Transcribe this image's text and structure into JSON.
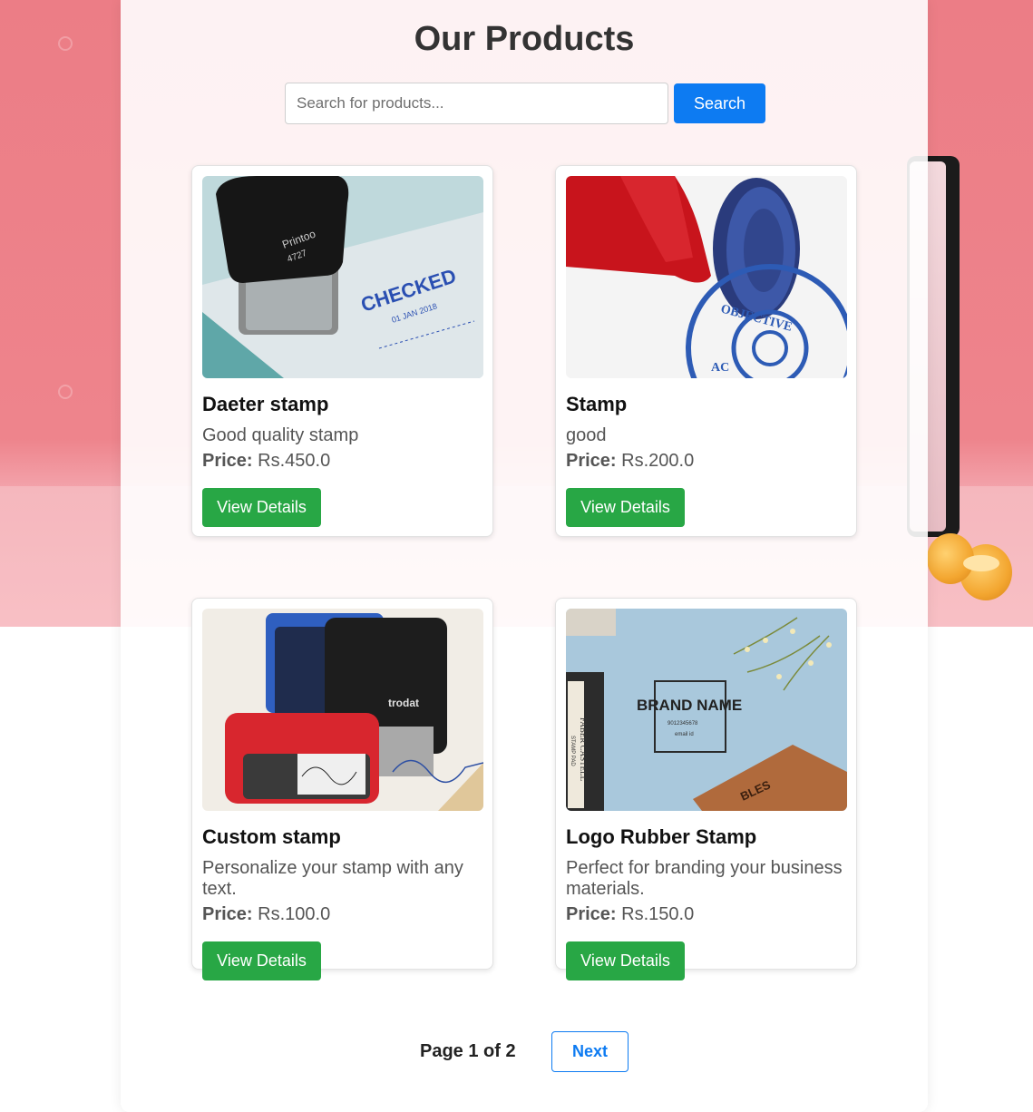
{
  "page": {
    "title": "Our Products"
  },
  "search": {
    "placeholder": "Search for products...",
    "button_label": "Search"
  },
  "products": [
    {
      "name": "Daeter stamp",
      "description": "Good quality stamp",
      "price_label": "Price:",
      "price": "Rs.450.0",
      "button_label": "View Details",
      "image_text": [
        "Printoo",
        "4727",
        "CHECKED",
        "01 JAN 2018"
      ]
    },
    {
      "name": "Stamp",
      "description": "good",
      "price_label": "Price:",
      "price": "Rs.200.0",
      "button_label": "View Details",
      "image_text": [
        "OBJECTIVE",
        "AC"
      ]
    },
    {
      "name": "Custom stamp",
      "description": "Personalize your stamp with any text.",
      "price_label": "Price:",
      "price": "Rs.100.0",
      "button_label": "View Details",
      "image_text": [
        "trodat"
      ]
    },
    {
      "name": "Logo Rubber Stamp",
      "description": "Perfect for branding your business materials.",
      "price_label": "Price:",
      "price": "Rs.150.0",
      "button_label": "View Details",
      "image_text": [
        "BRAND NAME",
        "9012345678",
        "email id",
        "FABER CASTELL",
        "STAMP PAD",
        "BLES"
      ]
    }
  ],
  "pagination": {
    "label": "Page 1 of 2",
    "next_label": "Next"
  },
  "colors": {
    "primary_blue": "#0d7bf2",
    "success_green": "#28a745",
    "background_pink": "#ec7d86"
  }
}
